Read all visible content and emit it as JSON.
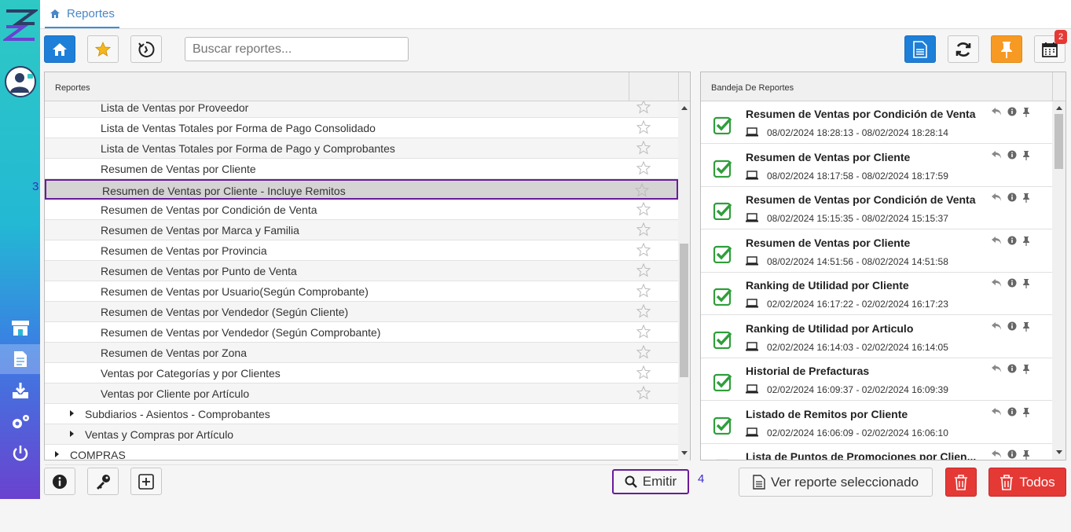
{
  "breadcrumb": {
    "home_label": "Reportes"
  },
  "search": {
    "placeholder": "Buscar reportes..."
  },
  "toolbar": {
    "calendar_badge": "2"
  },
  "reports_panel": {
    "header": "Reportes",
    "rows": [
      {
        "label": "Lista de Ventas por Proveedor",
        "indent": 2,
        "type": "leaf"
      },
      {
        "label": "Lista de Ventas Totales por Forma de Pago Consolidado",
        "indent": 2,
        "type": "leaf"
      },
      {
        "label": "Lista de Ventas Totales por Forma de Pago y Comprobantes",
        "indent": 2,
        "type": "leaf"
      },
      {
        "label": "Resumen de Ventas por Cliente",
        "indent": 2,
        "type": "leaf"
      },
      {
        "label": "Resumen de Ventas por Cliente - Incluye Remitos",
        "indent": 2,
        "type": "leaf",
        "selected": true
      },
      {
        "label": "Resumen de Ventas por Condición de Venta",
        "indent": 2,
        "type": "leaf"
      },
      {
        "label": "Resumen de Ventas por Marca y Familia",
        "indent": 2,
        "type": "leaf"
      },
      {
        "label": "Resumen de Ventas por Provincia",
        "indent": 2,
        "type": "leaf"
      },
      {
        "label": "Resumen de Ventas por Punto de Venta",
        "indent": 2,
        "type": "leaf"
      },
      {
        "label": "Resumen de Ventas por Usuario(Según Comprobante)",
        "indent": 2,
        "type": "leaf"
      },
      {
        "label": "Resumen de Ventas por Vendedor (Según Cliente)",
        "indent": 2,
        "type": "leaf"
      },
      {
        "label": "Resumen de Ventas por Vendedor (Según Comprobante)",
        "indent": 2,
        "type": "leaf"
      },
      {
        "label": "Resumen de Ventas por Zona",
        "indent": 2,
        "type": "leaf"
      },
      {
        "label": "Ventas por Categorías y por Clientes",
        "indent": 2,
        "type": "leaf"
      },
      {
        "label": "Ventas por Cliente por Artículo",
        "indent": 2,
        "type": "leaf"
      },
      {
        "label": "Subdiarios - Asientos - Comprobantes",
        "indent": 1,
        "type": "folder"
      },
      {
        "label": "Ventas y Compras por Artículo",
        "indent": 1,
        "type": "folder"
      },
      {
        "label": "COMPRAS",
        "indent": 0,
        "type": "folder"
      }
    ]
  },
  "tray_panel": {
    "header": "Bandeja De Reportes",
    "items": [
      {
        "title": "Resumen de Ventas por Condición de Venta",
        "time": "08/02/2024 18:28:13 - 08/02/2024 18:28:14"
      },
      {
        "title": "Resumen de Ventas por Cliente",
        "time": "08/02/2024 18:17:58 - 08/02/2024 18:17:59"
      },
      {
        "title": "Resumen de Ventas por Condición de Venta",
        "time": "08/02/2024 15:15:35 - 08/02/2024 15:15:37"
      },
      {
        "title": "Resumen de Ventas por Cliente",
        "time": "08/02/2024 14:51:56 - 08/02/2024 14:51:58"
      },
      {
        "title": "Ranking de Utilidad por Cliente",
        "time": "02/02/2024 16:17:22 - 02/02/2024 16:17:23"
      },
      {
        "title": "Ranking de Utilidad por Articulo",
        "time": "02/02/2024 16:14:03 - 02/02/2024 16:14:05"
      },
      {
        "title": "Historial de Prefacturas",
        "time": "02/02/2024 16:09:37 - 02/02/2024 16:09:39"
      },
      {
        "title": "Listado de Remitos por Cliente",
        "time": "02/02/2024 16:06:09 - 02/02/2024 16:06:10"
      },
      {
        "title": "Lista de Puntos de Promociones por Clien...",
        "time": ""
      }
    ]
  },
  "footer": {
    "emit_label": "Emitir",
    "view_selected_label": "Ver reporte seleccionado",
    "all_label": "Todos"
  },
  "annotations": {
    "row_marker": "3",
    "emit_marker": "4"
  }
}
